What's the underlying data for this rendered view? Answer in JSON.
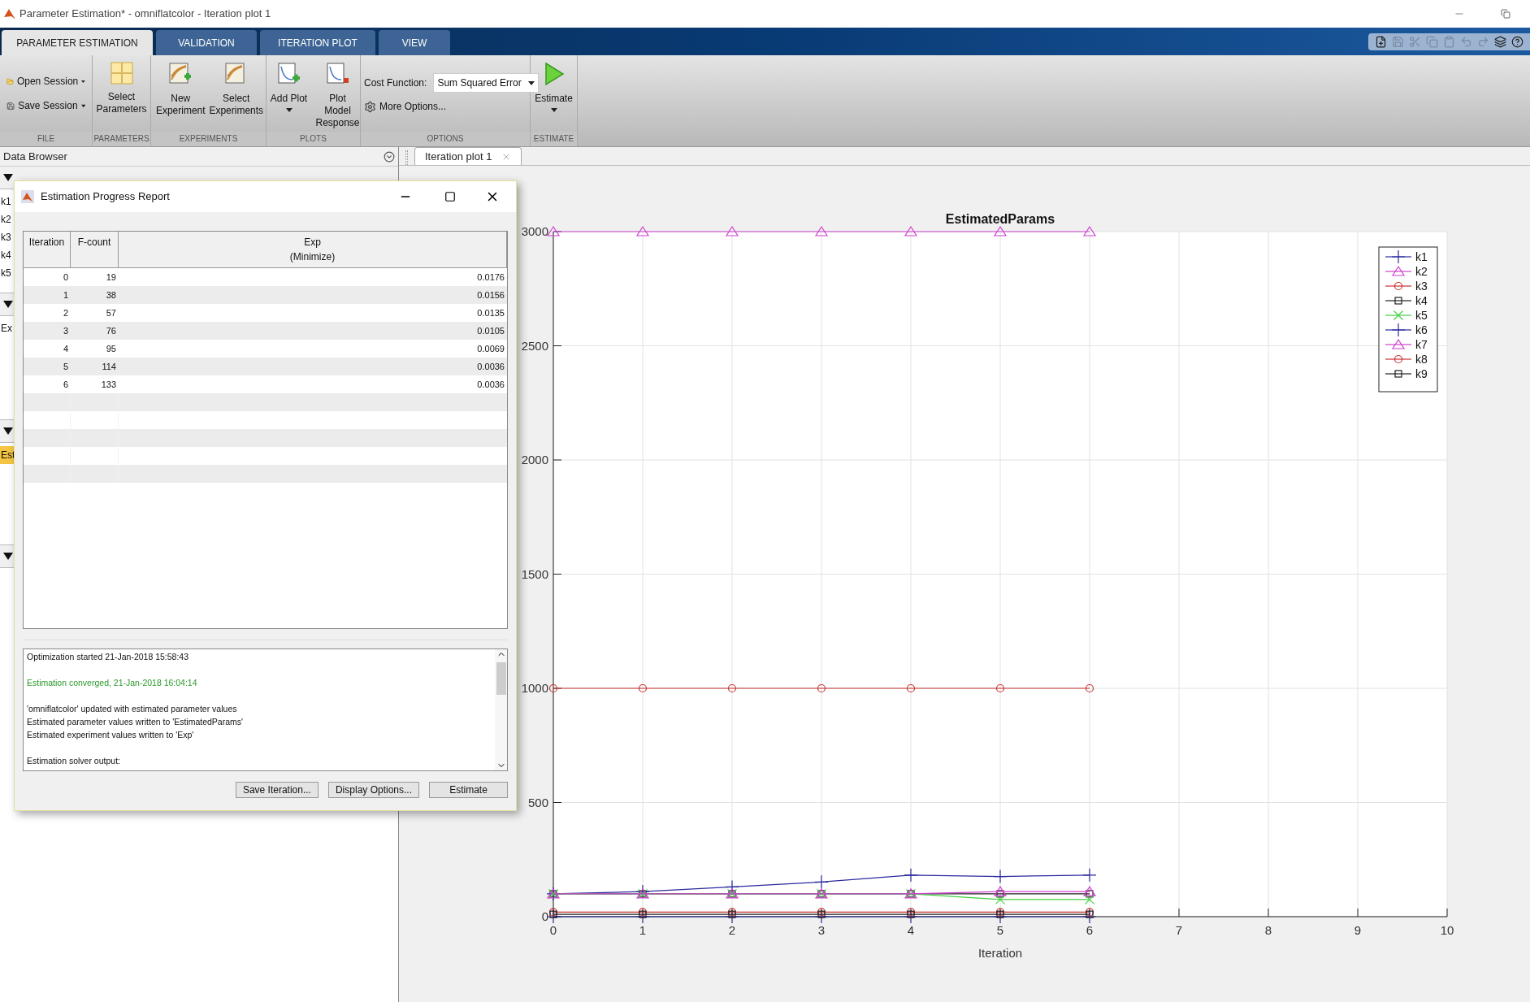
{
  "window": {
    "title": "Parameter Estimation* - omniflatcolor - Iteration plot 1"
  },
  "tabs": [
    {
      "label": "PARAMETER ESTIMATION",
      "selected": true
    },
    {
      "label": "VALIDATION",
      "selected": false
    },
    {
      "label": "ITERATION PLOT",
      "selected": false
    },
    {
      "label": "VIEW",
      "selected": false
    }
  ],
  "ribbon": {
    "groups": [
      {
        "label": "FILE",
        "items": [
          {
            "kind": "menu",
            "label": "Open Session"
          },
          {
            "kind": "menu",
            "label": "Save Session"
          }
        ]
      },
      {
        "label": "PARAMETERS",
        "items": [
          {
            "kind": "large",
            "label": "Select Parameters",
            "dropdown": false
          }
        ]
      },
      {
        "label": "EXPERIMENTS",
        "items": [
          {
            "kind": "large",
            "label": "New Experiment",
            "dropdown": false
          },
          {
            "kind": "large",
            "label": "Select Experiments",
            "dropdown": false
          }
        ]
      },
      {
        "label": "PLOTS",
        "items": [
          {
            "kind": "large",
            "label": "Add Plot",
            "dropdown": true
          },
          {
            "kind": "large",
            "label": "Plot Model Response",
            "dropdown": false
          }
        ]
      },
      {
        "label": "OPTIONS",
        "items": [
          {
            "kind": "select",
            "label": "Cost Function:",
            "value": "Sum Squared Error"
          },
          {
            "kind": "link",
            "label": "More Options..."
          }
        ]
      },
      {
        "label": "ESTIMATE",
        "items": [
          {
            "kind": "large",
            "label": "Estimate",
            "dropdown": true
          }
        ]
      }
    ]
  },
  "data_browser": {
    "title": "Data Browser",
    "sections": [
      {
        "expanded": true,
        "items": [
          {
            "label": "k1",
            "selected": false
          },
          {
            "label": "k2",
            "selected": false
          },
          {
            "label": "k3",
            "selected": false
          },
          {
            "label": "k4",
            "selected": false
          },
          {
            "label": "k5",
            "selected": false
          }
        ]
      },
      {
        "expanded": true,
        "items": [
          {
            "label": "Ex",
            "selected": false
          }
        ]
      },
      {
        "expanded": true,
        "items": [
          {
            "label": "Est",
            "selected": true
          }
        ]
      },
      {
        "expanded": true
      }
    ]
  },
  "document_tabs": [
    {
      "label": "Iteration plot 1",
      "selected": true
    }
  ],
  "plot": {
    "chart_data": {
      "type": "line",
      "title": "EstimatedParams",
      "xlabel": "Iteration",
      "x": [
        0,
        1,
        2,
        3,
        4,
        5,
        6
      ],
      "xlim": [
        0,
        10
      ],
      "ylim": [
        0,
        3000
      ],
      "xticks": [
        0,
        1,
        2,
        3,
        4,
        5,
        6,
        7,
        8,
        9,
        10
      ],
      "yticks": [
        0,
        500,
        1000,
        1500,
        2000,
        2500,
        3000
      ],
      "grid": true,
      "legend": true,
      "series": [
        {
          "name": "k1",
          "color": "#2a2aa0",
          "marker": "plus",
          "values": [
            100,
            110,
            130,
            152,
            182,
            176,
            182
          ]
        },
        {
          "name": "k2",
          "color": "#d040d0",
          "marker": "triangle",
          "values": [
            3000,
            3000,
            3000,
            3000,
            3000,
            3000,
            3000
          ]
        },
        {
          "name": "k3",
          "color": "#c83232",
          "marker": "circle",
          "values": [
            1000,
            1000,
            1000,
            1000,
            1000,
            1000,
            1000
          ]
        },
        {
          "name": "k4",
          "color": "#202020",
          "marker": "square",
          "values": [
            100,
            100,
            100,
            100,
            100,
            100,
            100
          ]
        },
        {
          "name": "k5",
          "color": "#40d040",
          "marker": "x",
          "values": [
            100,
            100,
            100,
            100,
            100,
            75,
            75
          ]
        },
        {
          "name": "k6",
          "color": "#2a2aa0",
          "marker": "plus",
          "values": [
            0,
            0,
            0,
            0,
            0,
            0,
            0
          ]
        },
        {
          "name": "k7",
          "color": "#d040d0",
          "marker": "triangle",
          "values": [
            100,
            100,
            100,
            100,
            100,
            110,
            110
          ]
        },
        {
          "name": "k8",
          "color": "#c83232",
          "marker": "circle",
          "values": [
            20,
            20,
            20,
            20,
            20,
            20,
            20
          ]
        },
        {
          "name": "k9",
          "color": "#202020",
          "marker": "square",
          "values": [
            10,
            10,
            10,
            10,
            10,
            10,
            10
          ]
        }
      ]
    }
  },
  "progress_dialog": {
    "title": "Estimation Progress Report",
    "columns": [
      {
        "label": "Iteration"
      },
      {
        "label": "F-count"
      },
      {
        "label": "Exp",
        "sublabel": "(Minimize)"
      }
    ],
    "rows": [
      [
        "0",
        "19",
        "0.0176"
      ],
      [
        "1",
        "38",
        "0.0156"
      ],
      [
        "2",
        "57",
        "0.0135"
      ],
      [
        "3",
        "76",
        "0.0105"
      ],
      [
        "4",
        "95",
        "0.0069"
      ],
      [
        "5",
        "114",
        "0.0036"
      ],
      [
        "6",
        "133",
        "0.0036"
      ]
    ],
    "log": [
      {
        "kind": "info",
        "text": "Optimization started 21-Jan-2018 15:58:43"
      },
      {
        "kind": "success",
        "text": "Estimation converged, 21-Jan-2018 16:04:14"
      },
      {
        "kind": "info",
        "text": "'omniflatcolor' updated with estimated parameter values"
      },
      {
        "kind": "info",
        "text": "Estimated parameter values written to 'EstimatedParams'"
      },
      {
        "kind": "info",
        "text": "Estimated experiment values written to 'Exp'"
      },
      {
        "kind": "info",
        "text": "Estimation solver output:"
      }
    ],
    "buttons": [
      "Save Iteration...",
      "Display Options...",
      "Estimate"
    ]
  }
}
